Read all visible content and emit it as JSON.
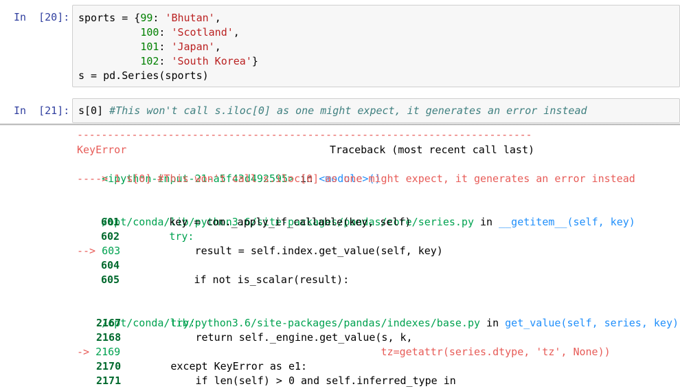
{
  "cells": [
    {
      "prompt": "In  [20]:",
      "lines": [
        "sports = {99: 'Bhutan',",
        "          100: 'Scotland',",
        "          101: 'Japan',",
        "          102: 'South Korea'}",
        "s = pd.Series(sports)"
      ]
    },
    {
      "prompt": "In  [21]:",
      "code": "s[0] ",
      "comment": "#This won't call s.iloc[0] as one might expect, it generates an error instead"
    }
  ],
  "traceback": {
    "dashes": "---------------------------------------------------------------------------",
    "error_name": "KeyError",
    "header_right": "Traceback (most recent call last)",
    "input_ref": "<ipython-input-21-a5f43d492595>",
    "in_word": " in ",
    "module_ref": "<module>()",
    "arrow_line": "----> 1 s[0] #This won't call s.iloc[0] as one might expect, it generates an error instead",
    "frame1": {
      "path": "/opt/conda/lib/python3.6/site-packages/pandas/core/series.py",
      "in_word": " in ",
      "func": "__getitem__",
      "args": "(self, key)",
      "lines": [
        {
          "num": "601",
          "arrow": "",
          "code": "        key = com._apply_if_callable(key, self)"
        },
        {
          "num": "602",
          "arrow": "",
          "code": "        try:"
        },
        {
          "num": "603",
          "arrow": "--> ",
          "code": "            result = self.index.get_value(self, key)"
        },
        {
          "num": "604",
          "arrow": "",
          "code": ""
        },
        {
          "num": "605",
          "arrow": "",
          "code": "            if not is_scalar(result):"
        }
      ]
    },
    "frame2": {
      "path": "/opt/conda/lib/python3.6/site-packages/pandas/indexes/base.py",
      "in_word": " in ",
      "func": "get_value",
      "args": "(self, series, key)",
      "lines": [
        {
          "num": "2167",
          "arrow": "",
          "code": "        try:"
        },
        {
          "num": "2168",
          "arrow": "",
          "code": "            return self._engine.get_value(s, k,"
        },
        {
          "num": "2169",
          "arrow": "-> ",
          "code": "                                          tz=getattr(series.dtype, 'tz', None))"
        },
        {
          "num": "2170",
          "arrow": "",
          "code": "        except KeyError as e1:"
        },
        {
          "num": "2171",
          "arrow": "",
          "code": "            if len(self) > 0 and self.inferred_type in"
        }
      ]
    }
  },
  "colors": {
    "prompt": "#303f9f",
    "error": "#e75c58",
    "link": "#208ffb",
    "lineno": "#00692d"
  }
}
